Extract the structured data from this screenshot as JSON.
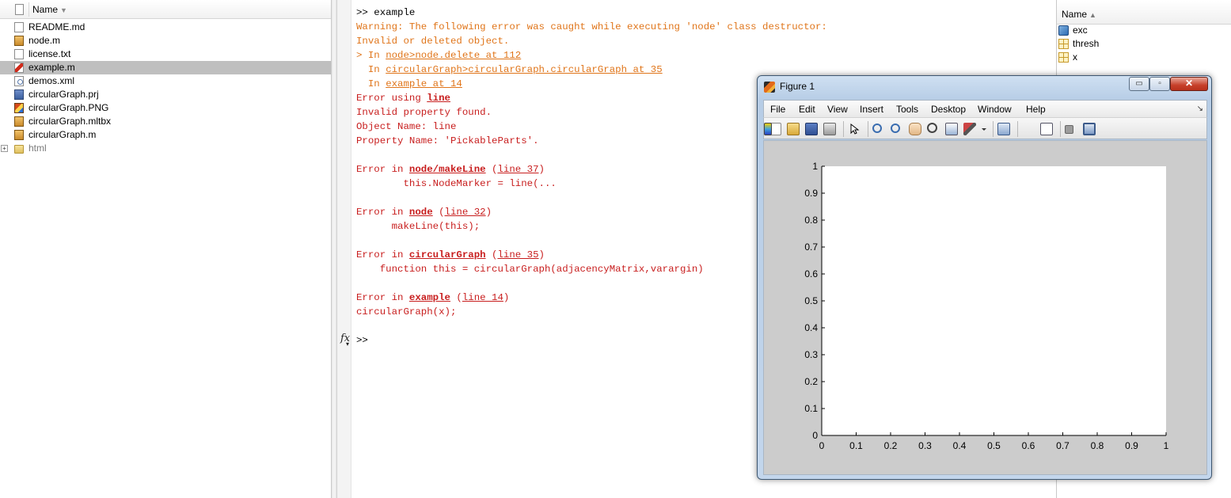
{
  "file_browser": {
    "header_name": "Name",
    "sort_indicator": "▼",
    "files": [
      {
        "name": "README.md",
        "icon": "markdown-file-icon",
        "selected": false
      },
      {
        "name": "node.m",
        "icon": "matlab-class-file-icon",
        "selected": false
      },
      {
        "name": "license.txt",
        "icon": "text-file-icon",
        "selected": false
      },
      {
        "name": "example.m",
        "icon": "matlab-script-file-icon",
        "selected": true
      },
      {
        "name": "demos.xml",
        "icon": "xml-file-icon",
        "selected": false
      },
      {
        "name": "circularGraph.prj",
        "icon": "project-file-icon",
        "selected": false
      },
      {
        "name": "circularGraph.PNG",
        "icon": "image-file-icon",
        "selected": false
      },
      {
        "name": "circularGraph.mltbx",
        "icon": "toolbox-file-icon",
        "selected": false
      },
      {
        "name": "circularGraph.m",
        "icon": "matlab-class-file-icon",
        "selected": false
      },
      {
        "name": "html",
        "icon": "folder-icon",
        "selected": false,
        "is_folder": true,
        "expander": "+"
      }
    ]
  },
  "command_window": {
    "lines": [
      {
        "segments": [
          {
            "text": ">> example",
            "cls": "c-black"
          }
        ]
      },
      {
        "segments": [
          {
            "text": "Warning: The following error was caught while executing 'node' class destructor:",
            "cls": "c-orange"
          }
        ]
      },
      {
        "segments": [
          {
            "text": "Invalid or deleted object.",
            "cls": "c-orange"
          }
        ]
      },
      {
        "segments": [
          {
            "text": "> In ",
            "cls": "c-orange"
          },
          {
            "text": "node>node.delete at 112",
            "cls": "c-orange lnk-u"
          }
        ]
      },
      {
        "segments": [
          {
            "text": "  In ",
            "cls": "c-orange"
          },
          {
            "text": "circularGraph>circularGraph.circularGraph at 35",
            "cls": "c-orange lnk-u"
          }
        ]
      },
      {
        "segments": [
          {
            "text": "  In ",
            "cls": "c-orange"
          },
          {
            "text": "example at 14",
            "cls": "c-orange lnk-u"
          }
        ]
      },
      {
        "segments": [
          {
            "text": "Error using ",
            "cls": "c-red"
          },
          {
            "text": "line",
            "cls": "c-red lnk-bold"
          }
        ]
      },
      {
        "segments": [
          {
            "text": "Invalid property found.",
            "cls": "c-red"
          }
        ]
      },
      {
        "segments": [
          {
            "text": "Object Name: line",
            "cls": "c-red"
          }
        ]
      },
      {
        "segments": [
          {
            "text": "Property Name: 'PickableParts'.",
            "cls": "c-red"
          }
        ]
      },
      {
        "segments": []
      },
      {
        "segments": [
          {
            "text": "Error in ",
            "cls": "c-red"
          },
          {
            "text": "node/makeLine",
            "cls": "c-red lnk-bold"
          },
          {
            "text": " (",
            "cls": "c-red"
          },
          {
            "text": "line 37",
            "cls": "c-red lnk-u"
          },
          {
            "text": ")",
            "cls": "c-red"
          }
        ]
      },
      {
        "segments": [
          {
            "text": "        this.NodeMarker = line(...",
            "cls": "c-red"
          }
        ]
      },
      {
        "segments": []
      },
      {
        "segments": [
          {
            "text": "Error in ",
            "cls": "c-red"
          },
          {
            "text": "node",
            "cls": "c-red lnk-bold"
          },
          {
            "text": " (",
            "cls": "c-red"
          },
          {
            "text": "line 32",
            "cls": "c-red lnk-u"
          },
          {
            "text": ")",
            "cls": "c-red"
          }
        ]
      },
      {
        "segments": [
          {
            "text": "      makeLine(this);",
            "cls": "c-red"
          }
        ]
      },
      {
        "segments": []
      },
      {
        "segments": [
          {
            "text": "Error in ",
            "cls": "c-red"
          },
          {
            "text": "circularGraph",
            "cls": "c-red lnk-bold"
          },
          {
            "text": " (",
            "cls": "c-red"
          },
          {
            "text": "line 35",
            "cls": "c-red lnk-u"
          },
          {
            "text": ")",
            "cls": "c-red"
          }
        ]
      },
      {
        "segments": [
          {
            "text": "    function this = circularGraph(adjacencyMatrix,varargin)",
            "cls": "c-red"
          }
        ]
      },
      {
        "segments": []
      },
      {
        "segments": [
          {
            "text": "Error in ",
            "cls": "c-red"
          },
          {
            "text": "example",
            "cls": "c-red lnk-bold"
          },
          {
            "text": " (",
            "cls": "c-red"
          },
          {
            "text": "line 14",
            "cls": "c-red lnk-u"
          },
          {
            "text": ")",
            "cls": "c-red"
          }
        ]
      },
      {
        "segments": [
          {
            "text": "circularGraph(x);",
            "cls": "c-red"
          }
        ]
      },
      {
        "segments": []
      },
      {
        "segments": [
          {
            "text": ">>",
            "cls": "c-black"
          }
        ]
      }
    ],
    "fx_label": "fx",
    "fx_arrow": "▾"
  },
  "workspace": {
    "header_name": "Name",
    "sort_indicator": "▲",
    "variables": [
      {
        "name": "exc",
        "icon": "object-variable-icon"
      },
      {
        "name": "thresh",
        "icon": "matrix-variable-icon"
      },
      {
        "name": "x",
        "icon": "matrix-variable-icon"
      }
    ]
  },
  "figure": {
    "title": "Figure 1",
    "window_buttons": {
      "minimize": "▭",
      "maximize": "▫",
      "close": "✕"
    },
    "menu": [
      "File",
      "Edit",
      "View",
      "Insert",
      "Tools",
      "Desktop",
      "Window",
      "Help"
    ],
    "menu_grip": "↘",
    "toolbar": [
      "new-figure-icon",
      "open-file-icon",
      "save-icon",
      "print-icon",
      "|",
      "edit-plot-arrow-icon",
      "|",
      "zoom-in-icon",
      "zoom-out-icon",
      "pan-hand-icon",
      "rotate-3d-icon",
      "data-cursor-icon",
      "brush-icon",
      "brush-dropdown-icon",
      "|",
      "link-plot-icon",
      "|",
      "colorbar-icon",
      "legend-icon",
      "|",
      "hide-plot-tools-icon",
      "show-plot-tools-icon"
    ],
    "colors": {
      "window_frame": "#b7cde6",
      "plot_background": "#cccccc",
      "close_button": "#c7402a"
    }
  },
  "chart_data": {
    "type": "line",
    "title": "",
    "xlabel": "",
    "ylabel": "",
    "xlim": [
      0,
      1
    ],
    "ylim": [
      0,
      1
    ],
    "xticks": [
      "0",
      "0.1",
      "0.2",
      "0.3",
      "0.4",
      "0.5",
      "0.6",
      "0.7",
      "0.8",
      "0.9",
      "1"
    ],
    "yticks": [
      "0",
      "0.1",
      "0.2",
      "0.3",
      "0.4",
      "0.5",
      "0.6",
      "0.7",
      "0.8",
      "0.9",
      "1"
    ],
    "grid": false,
    "series": []
  }
}
